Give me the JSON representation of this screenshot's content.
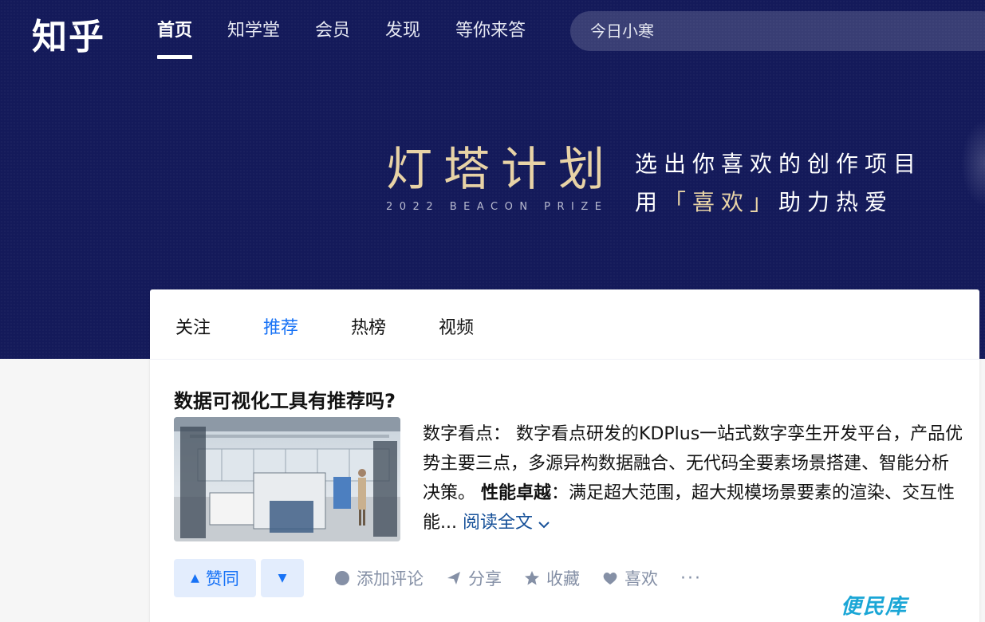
{
  "header": {
    "logo": "知乎",
    "nav": [
      {
        "label": "首页",
        "active": true
      },
      {
        "label": "知学堂",
        "active": false
      },
      {
        "label": "会员",
        "active": false
      },
      {
        "label": "发现",
        "active": false
      },
      {
        "label": "等你来答",
        "active": false
      }
    ],
    "search": {
      "placeholder": "今日小寒"
    }
  },
  "banner": {
    "title": "灯塔计划",
    "subtitle": "2022 BEACON PRIZE",
    "line1": "选出你喜欢的创作项目",
    "line2_before": "用",
    "line2_highlight": "「喜欢」",
    "line2_after": "助力热爱",
    "accent_color": "#e8d3a6",
    "background_color": "#141a5a"
  },
  "feed": {
    "tabs": [
      {
        "label": "关注",
        "active": false
      },
      {
        "label": "推荐",
        "active": true
      },
      {
        "label": "热榜",
        "active": false
      },
      {
        "label": "视频",
        "active": false
      }
    ],
    "item": {
      "title": "数据可视化工具有推荐吗?",
      "author": "数字看点：",
      "text1": "数字看点研发的KDPlus一站式数字孪生开发平台，产品优势主要三点，多源异构数据融合、无代码全要素场景搭建、智能分析决策。",
      "bold": "性能卓越",
      "text2": "：满足超大范围，超大规模场景要素的渲染、交互性能...",
      "read_more": "阅读全文",
      "actions": {
        "upvote": "赞同",
        "comment": "添加评论",
        "share": "分享",
        "collect": "收藏",
        "like": "喜欢",
        "more": "···"
      }
    }
  },
  "watermark": "便民库",
  "colors": {
    "brand": "#1772f6",
    "link": "#175199",
    "muted": "#8590a6"
  }
}
